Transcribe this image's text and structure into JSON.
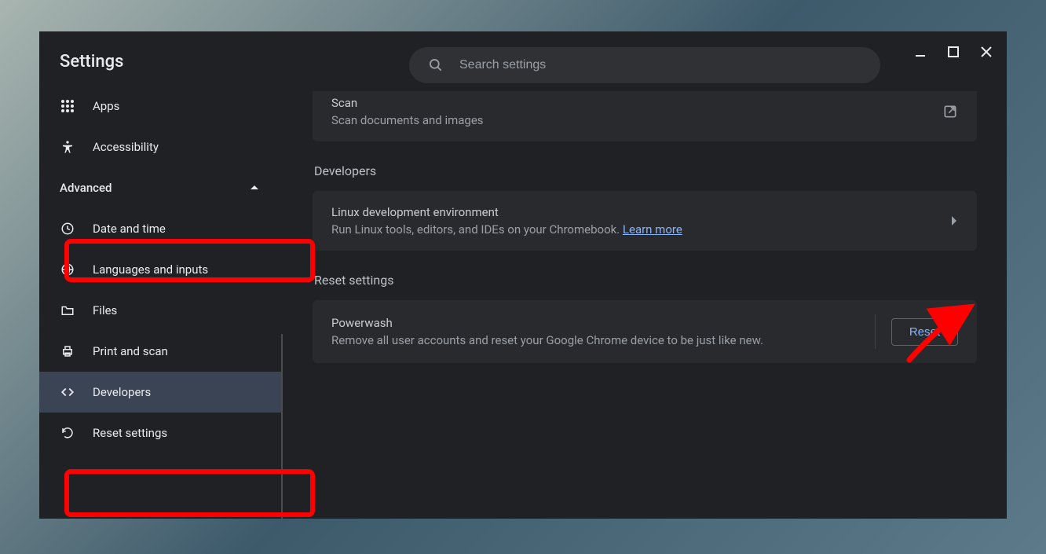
{
  "window": {
    "title": "Settings"
  },
  "search": {
    "placeholder": "Search settings"
  },
  "sidebar": {
    "items": [
      {
        "label": "Apps"
      },
      {
        "label": "Accessibility"
      }
    ],
    "advanced_label": "Advanced",
    "advanced_items": [
      {
        "label": "Date and time"
      },
      {
        "label": "Languages and inputs"
      },
      {
        "label": "Files"
      },
      {
        "label": "Print and scan"
      },
      {
        "label": "Developers"
      },
      {
        "label": "Reset settings"
      }
    ]
  },
  "main": {
    "scan": {
      "title": "Scan",
      "sub": "Scan documents and images"
    },
    "developers": {
      "header": "Developers",
      "linux_title": "Linux development environment",
      "linux_sub_pre": "Run Linux tools, editors, and IDEs on your Chromebook. ",
      "linux_learn": "Learn more"
    },
    "reset": {
      "header": "Reset settings",
      "pw_title": "Powerwash",
      "pw_sub": "Remove all user accounts and reset your Google Chrome device to be just like new.",
      "button": "Reset"
    }
  }
}
